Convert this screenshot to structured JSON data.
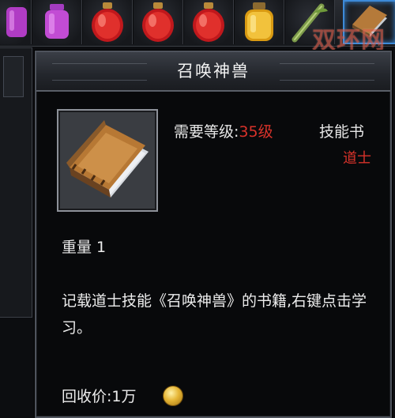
{
  "watermark": "双环网",
  "inventory": [
    {
      "icon": "purple-potion-icon"
    },
    {
      "icon": "magenta-potion-icon"
    },
    {
      "icon": "red-potion-icon"
    },
    {
      "icon": "red-potion-icon"
    },
    {
      "icon": "gold-potion-icon"
    },
    {
      "icon": "bamboo-item-icon"
    },
    {
      "icon": "skill-book-icon",
      "selected": true
    }
  ],
  "tooltip": {
    "title": "召唤神兽",
    "requirement_label": "需要等级:",
    "requirement_value": "35级",
    "item_type": "技能书",
    "class": "道士",
    "weight": "重量 1",
    "description": "记载道士技能《召唤神兽》的书籍,右键点击学习。",
    "price": "回收价:1万",
    "price_icon": "gold-coin-icon"
  },
  "colors": {
    "requirement": "#d8322a",
    "class": "#d8322a",
    "text": "#ededed",
    "selected_border": "#3d8ad8"
  }
}
